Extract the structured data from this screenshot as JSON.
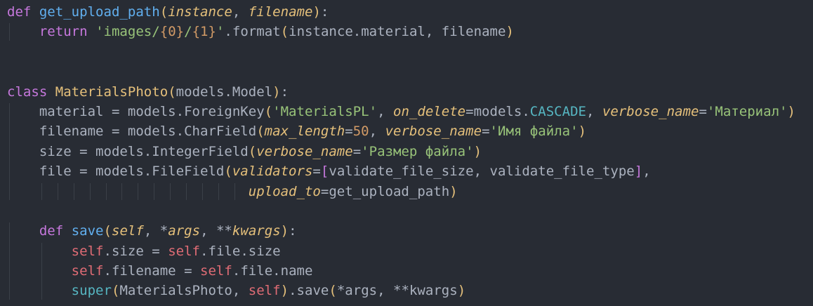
{
  "editor": {
    "language": "python",
    "theme_colors": {
      "background": "#282c34",
      "keyword": "#c678dd",
      "function": "#61afef",
      "parameter": "#e5c07b",
      "string": "#98c379",
      "number": "#d19a66",
      "self": "#e06c75",
      "builtin": "#56b6c2",
      "text": "#abb2bf",
      "indent_guide": "#3b4048"
    },
    "lines": [
      [
        [
          "kw",
          "def"
        ],
        [
          "tx",
          " "
        ],
        [
          "fn",
          "get_upload_path"
        ],
        [
          "b1",
          "("
        ],
        [
          "pm",
          "instance"
        ],
        [
          "tx",
          ", "
        ],
        [
          "pm",
          "filename"
        ],
        [
          "b1",
          ")"
        ],
        [
          "tx",
          ":"
        ]
      ],
      [
        [
          "tx",
          "    "
        ],
        [
          "kw",
          "return"
        ],
        [
          "tx",
          " "
        ],
        [
          "st",
          "'images/"
        ],
        [
          "fm",
          "{0}"
        ],
        [
          "st",
          "/"
        ],
        [
          "fm",
          "{1}"
        ],
        [
          "st",
          "'"
        ],
        [
          "tx",
          ".format"
        ],
        [
          "b1",
          "("
        ],
        [
          "tx",
          "instance.material, filename"
        ],
        [
          "b1",
          ")"
        ]
      ],
      [],
      [],
      [
        [
          "kw",
          "class"
        ],
        [
          "tx",
          " "
        ],
        [
          "cl",
          "MaterialsPhoto"
        ],
        [
          "b1",
          "("
        ],
        [
          "tx",
          "models.Model"
        ],
        [
          "b1",
          ")"
        ],
        [
          "tx",
          ":"
        ]
      ],
      [
        [
          "tx",
          "    material = models.ForeignKey"
        ],
        [
          "b1",
          "("
        ],
        [
          "st",
          "'MaterialsPL'"
        ],
        [
          "tx",
          ", "
        ],
        [
          "pm",
          "on_delete"
        ],
        [
          "tx",
          "=models."
        ],
        [
          "bi",
          "CASCADE"
        ],
        [
          "tx",
          ", "
        ],
        [
          "pm",
          "verbose_name"
        ],
        [
          "tx",
          "="
        ],
        [
          "st",
          "'Материал'"
        ],
        [
          "b1",
          ")"
        ]
      ],
      [
        [
          "tx",
          "    filename = models.CharField"
        ],
        [
          "b1",
          "("
        ],
        [
          "pm",
          "max_length"
        ],
        [
          "tx",
          "="
        ],
        [
          "nu",
          "50"
        ],
        [
          "tx",
          ", "
        ],
        [
          "pm",
          "verbose_name"
        ],
        [
          "tx",
          "="
        ],
        [
          "st",
          "'Имя файла'"
        ],
        [
          "b1",
          ")"
        ]
      ],
      [
        [
          "tx",
          "    size = models.IntegerField"
        ],
        [
          "b1",
          "("
        ],
        [
          "pm",
          "verbose_name"
        ],
        [
          "tx",
          "="
        ],
        [
          "st",
          "'Размер файла'"
        ],
        [
          "b1",
          ")"
        ]
      ],
      [
        [
          "tx",
          "    file = models.FileField"
        ],
        [
          "b1",
          "("
        ],
        [
          "pm",
          "validators"
        ],
        [
          "tx",
          "="
        ],
        [
          "b2",
          "["
        ],
        [
          "tx",
          "validate_file_size, validate_file_type"
        ],
        [
          "b2",
          "]"
        ],
        [
          "tx",
          ","
        ]
      ],
      [
        [
          "tx",
          "                              "
        ],
        [
          "pm",
          "upload_to"
        ],
        [
          "tx",
          "=get_upload_path"
        ],
        [
          "b1",
          ")"
        ]
      ],
      [],
      [
        [
          "tx",
          "    "
        ],
        [
          "kw",
          "def"
        ],
        [
          "tx",
          " "
        ],
        [
          "fn",
          "save"
        ],
        [
          "b1",
          "("
        ],
        [
          "pm",
          "self"
        ],
        [
          "tx",
          ", *"
        ],
        [
          "pm",
          "args"
        ],
        [
          "tx",
          ", **"
        ],
        [
          "pm",
          "kwargs"
        ],
        [
          "b1",
          ")"
        ],
        [
          "tx",
          ":"
        ]
      ],
      [
        [
          "tx",
          "        "
        ],
        [
          "sf",
          "self"
        ],
        [
          "tx",
          ".size = "
        ],
        [
          "sf",
          "self"
        ],
        [
          "tx",
          ".file.size"
        ]
      ],
      [
        [
          "tx",
          "        "
        ],
        [
          "sf",
          "self"
        ],
        [
          "tx",
          ".filename = "
        ],
        [
          "sf",
          "self"
        ],
        [
          "tx",
          ".file.name"
        ]
      ],
      [
        [
          "tx",
          "        "
        ],
        [
          "bi",
          "super"
        ],
        [
          "b1",
          "("
        ],
        [
          "tx",
          "MaterialsPhoto, "
        ],
        [
          "sf",
          "self"
        ],
        [
          "b1",
          ")"
        ],
        [
          "tx",
          ".save"
        ],
        [
          "b1",
          "("
        ],
        [
          "tx",
          "*args, **kwargs"
        ],
        [
          "b1",
          ")"
        ]
      ]
    ]
  }
}
